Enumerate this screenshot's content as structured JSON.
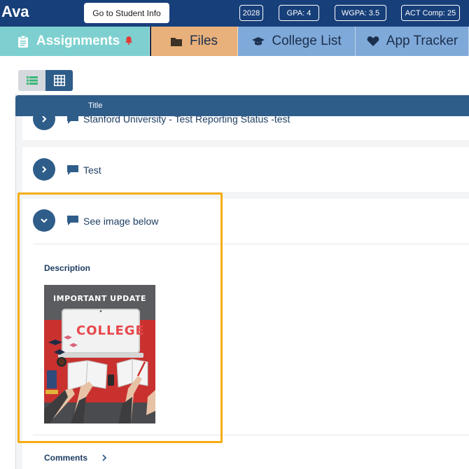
{
  "header": {
    "student_name": "Ava",
    "student_info_button": "Go to Student Info",
    "badges": {
      "year": "2028",
      "gpa": "GPA: 4",
      "wgpa": "WGPA: 3.5",
      "act": "ACT Comp: 25"
    }
  },
  "tabs": [
    {
      "label": "Assignments",
      "icon": "clipboard-icon",
      "has_alert": true
    },
    {
      "label": "Files",
      "icon": "folder-icon"
    },
    {
      "label": "College List",
      "icon": "graduation-cap-icon"
    },
    {
      "label": "App Tracker",
      "icon": "heart-icon"
    }
  ],
  "view_toggle": {
    "options": [
      "list-view",
      "grid-view"
    ],
    "selected": "grid-view"
  },
  "table": {
    "column_title": "Title",
    "rows": [
      {
        "title": "Stanford University - Test Reporting Status -test",
        "expanded": false
      },
      {
        "title": "Test",
        "expanded": false
      },
      {
        "title": "See image below",
        "expanded": true
      }
    ]
  },
  "expanded_item": {
    "description_label": "Description",
    "image": {
      "header_text": "IMPORTANT UPDATE",
      "screen_text": "COLLEGE"
    },
    "comments_label": "Comments"
  },
  "colors": {
    "header_bg": "#173f7a",
    "assignments_tab": "#7dd0cf",
    "files_tab": "#e8b07a",
    "college_tab": "#7fa9d8",
    "primary_blue": "#2f5d8a",
    "highlight": "#f6ad12"
  }
}
